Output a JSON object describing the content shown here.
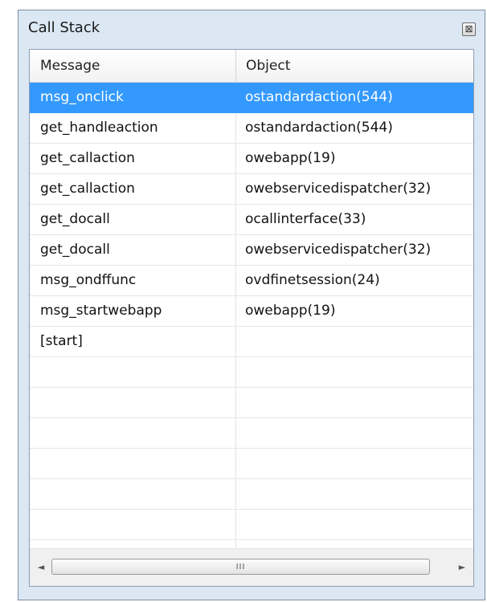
{
  "window": {
    "title": "Call Stack",
    "close_glyph": "⊠"
  },
  "table": {
    "columns": [
      "Message",
      "Object"
    ],
    "rows": [
      {
        "message": "msg_onclick",
        "object": "ostandardaction(544)",
        "selected": true
      },
      {
        "message": "get_handleaction",
        "object": "ostandardaction(544)"
      },
      {
        "message": "get_callaction",
        "object": "owebapp(19)"
      },
      {
        "message": "get_callaction",
        "object": "owebservicedispatcher(32)"
      },
      {
        "message": "get_docall",
        "object": "ocallinterface(33)"
      },
      {
        "message": "get_docall",
        "object": "owebservicedispatcher(32)"
      },
      {
        "message": "msg_ondffunc",
        "object": "ovdfinetsession(24)"
      },
      {
        "message": "msg_startwebapp",
        "object": "owebapp(19)"
      },
      {
        "message": "[start]",
        "object": ""
      },
      {
        "message": "",
        "object": ""
      },
      {
        "message": "",
        "object": ""
      },
      {
        "message": "",
        "object": ""
      },
      {
        "message": "",
        "object": ""
      },
      {
        "message": "",
        "object": ""
      },
      {
        "message": "",
        "object": ""
      }
    ]
  },
  "scrollbar": {
    "left_arrow": "◄",
    "right_arrow": "►",
    "grip": "III"
  },
  "colors": {
    "selection": "#3399ff",
    "frame": "#dce7f4"
  }
}
